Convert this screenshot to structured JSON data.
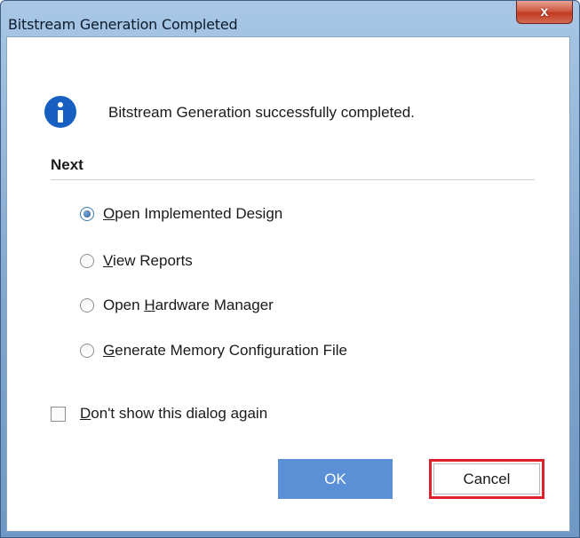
{
  "window": {
    "title": "Bitstream Generation Completed",
    "close_label": "x"
  },
  "dialog": {
    "icon": "info-icon",
    "message": "Bitstream Generation successfully completed.",
    "section_label": "Next",
    "options": [
      {
        "mnemonic_pre": "",
        "mnemonic": "O",
        "rest": "pen Implemented Design",
        "checked": true
      },
      {
        "mnemonic_pre": "",
        "mnemonic": "V",
        "rest": "iew Reports",
        "checked": false
      },
      {
        "mnemonic_pre": "Open ",
        "mnemonic": "H",
        "rest": "ardware Manager",
        "checked": false
      },
      {
        "mnemonic_pre": "",
        "mnemonic": "G",
        "rest": "enerate Memory Configuration File",
        "checked": false
      }
    ],
    "dont_show": {
      "mnemonic": "D",
      "rest": "on't show this dialog again",
      "checked": false
    },
    "ok_label": "OK",
    "cancel_label": "Cancel"
  },
  "colors": {
    "ok_button": "#5b8fd6",
    "cancel_highlight": "#e0202a",
    "info_icon": "#1760c2"
  }
}
